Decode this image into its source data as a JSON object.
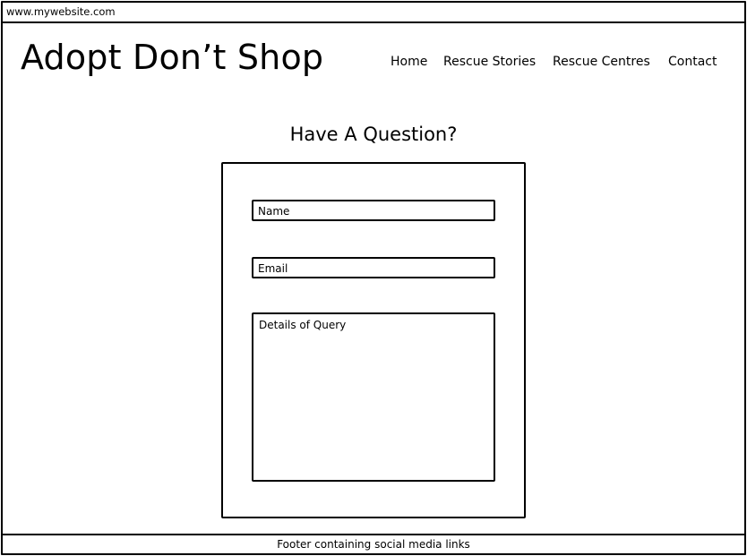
{
  "browser": {
    "url": "www.mywebsite.com"
  },
  "header": {
    "logo": "Adopt Don’t Shop",
    "nav": [
      "Home",
      "Rescue Stories",
      "Rescue Centres",
      "Contact"
    ]
  },
  "main": {
    "heading": "Have A Question?",
    "form": {
      "name_placeholder": "Name",
      "email_placeholder": "Email",
      "query_placeholder": "Details of Query"
    }
  },
  "footer": {
    "text": "Footer containing social media links"
  }
}
